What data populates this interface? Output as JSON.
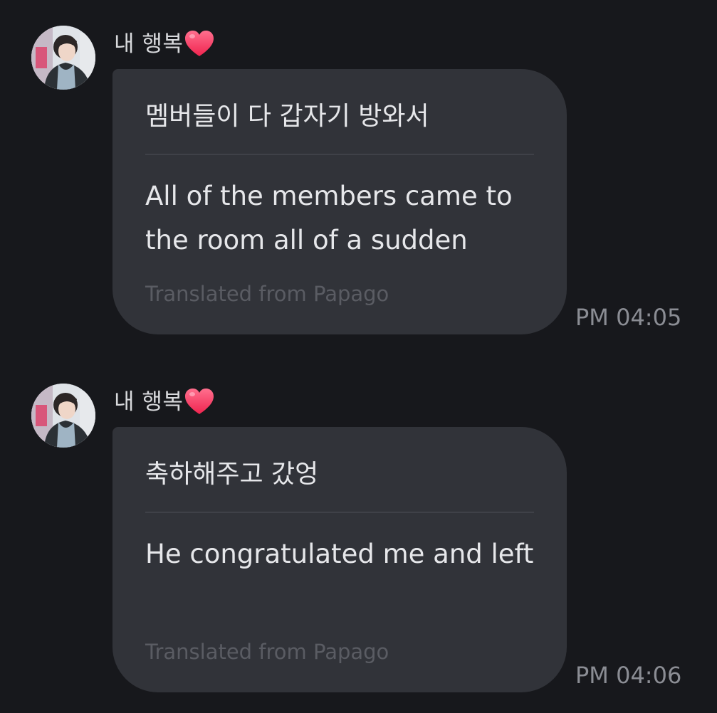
{
  "messages": [
    {
      "sender": "내 행복",
      "sender_icon": "heart-icon",
      "original": "멤버들이 다 갑자기 방와서",
      "translated": "All of the members came to the room all of a sudden",
      "footnote": "Translated from Papago",
      "time": "PM 04:05"
    },
    {
      "sender": "내 행복",
      "sender_icon": "heart-icon",
      "original": "축하해주고 갔엉",
      "translated": "He congratulated me and left",
      "footnote": "Translated from Papago",
      "time": "PM 04:06"
    }
  ],
  "colors": {
    "background": "#17181c",
    "bubble": "#313339",
    "heart": "#ff3d6e"
  }
}
